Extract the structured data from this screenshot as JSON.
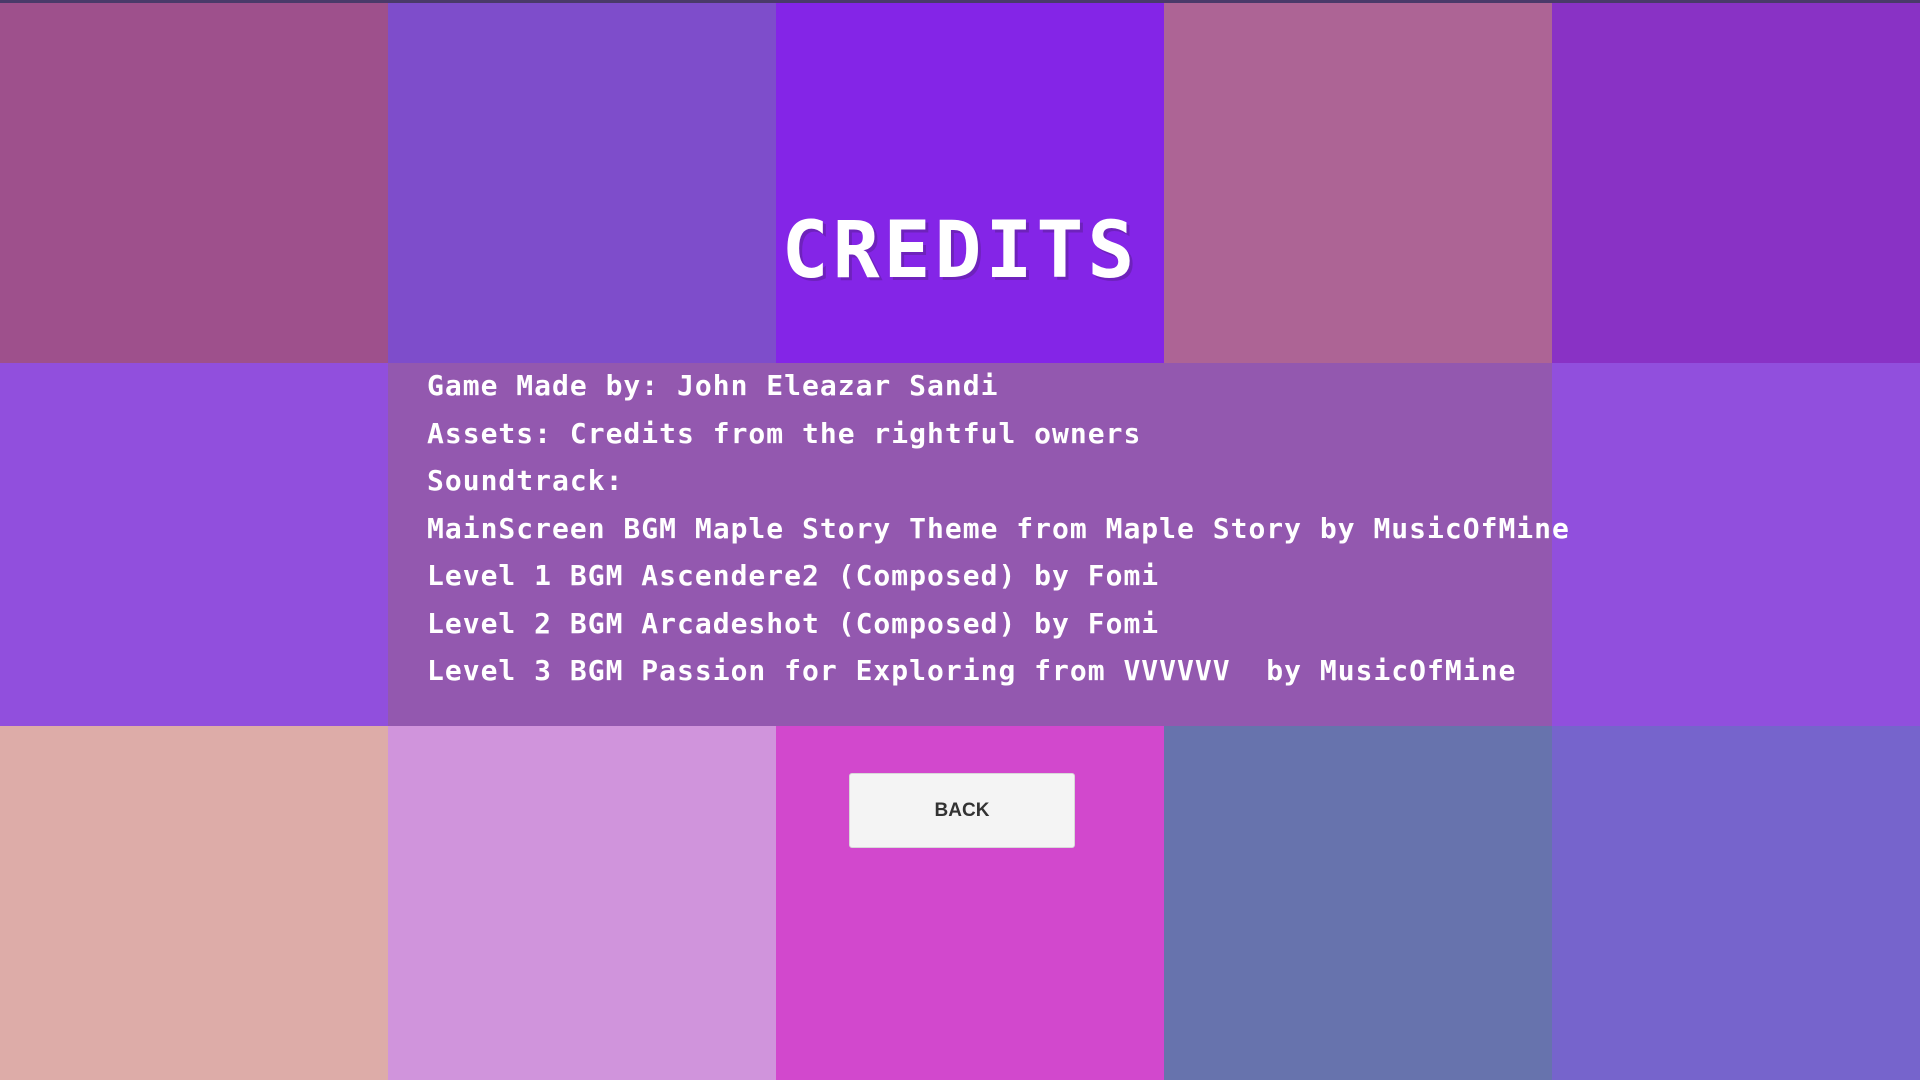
{
  "screen": {
    "title": "CREDITS",
    "credits": [
      "Game Made by: John Eleazar Sandi",
      "Assets: Credits from the rightful owners",
      "Soundtrack:",
      "MainScreen BGM Maple Story Theme from Maple Story by MusicOfMine",
      "Level 1 BGM Ascendere2 (Composed) by Fomi",
      "Level 2 BGM Arcadeshot (Composed) by Fomi",
      "Level 3 BGM Passion for Exploring from VVVVVV  by MusicOfMine"
    ],
    "back_label": "BACK"
  },
  "tile_colors": [
    "#9e508c",
    "#7e4dcb",
    "#8425e7",
    "#ad6495",
    "#8932c5",
    "#914fdd",
    "#914fdd",
    "#914fdd",
    "#914fdd",
    "#914fdd",
    "#ddaca8",
    "#d094dc",
    "#d248cd",
    "#6773ad",
    "#7664cc"
  ],
  "colors": {
    "title": "#ffffff",
    "credit_text": "#ffffff",
    "panel_tint": "rgba(150, 100, 120, 0.45)",
    "button_bg": "#f4f4f4",
    "button_text": "#333333"
  }
}
